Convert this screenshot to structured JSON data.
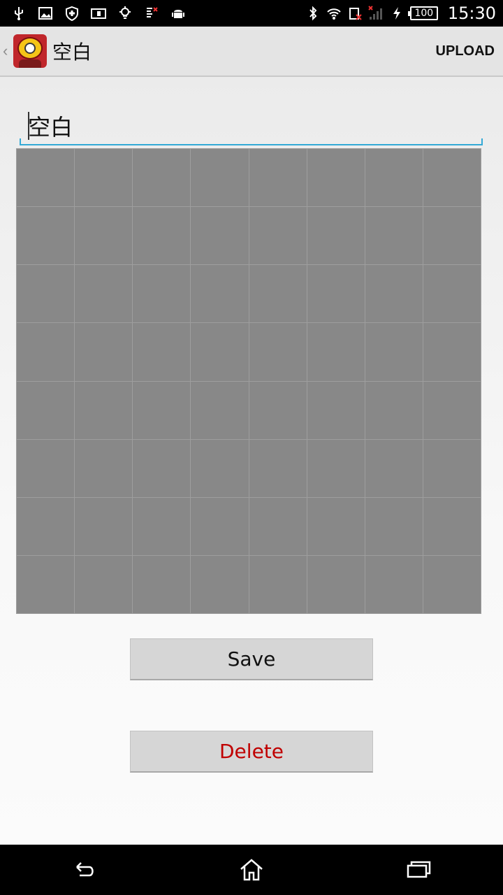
{
  "status_bar": {
    "left_icons": [
      "usb-icon",
      "image-icon",
      "shield-icon",
      "info-card-icon",
      "lightbulb-icon",
      "sd-card-icon",
      "android-icon"
    ],
    "right_icons": [
      "bluetooth-icon",
      "wifi-icon",
      "sim-icon",
      "signal-icon",
      "charging-icon"
    ],
    "battery": "100",
    "time": "15:30"
  },
  "action_bar": {
    "title": "空白",
    "upload_label": "UPLOAD"
  },
  "editor": {
    "name_value": "空白",
    "grid": {
      "rows": 8,
      "cols": 8,
      "cell_color": "#888888"
    }
  },
  "buttons": {
    "save_label": "Save",
    "delete_label": "Delete"
  },
  "colors": {
    "accent": "#33a9d6",
    "delete_text": "#c00000"
  },
  "nav_bar": {
    "icons": [
      "back-icon",
      "home-icon",
      "recents-icon"
    ]
  }
}
